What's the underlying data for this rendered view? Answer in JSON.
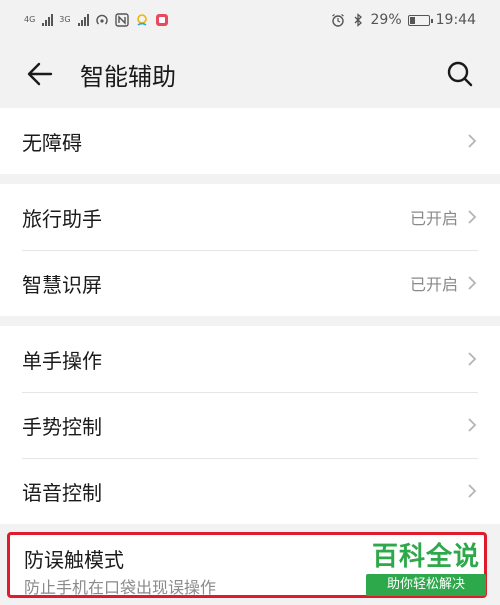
{
  "status_bar": {
    "net1": "4G",
    "net2": "3G",
    "battery_percent_text": "29%",
    "battery_level": 0.29,
    "time": "19:44"
  },
  "header": {
    "title": "智能辅助"
  },
  "groups": [
    {
      "items": [
        {
          "label": "无障碍",
          "value": ""
        }
      ]
    },
    {
      "items": [
        {
          "label": "旅行助手",
          "value": "已开启"
        },
        {
          "label": "智慧识屏",
          "value": "已开启"
        }
      ]
    },
    {
      "items": [
        {
          "label": "单手操作",
          "value": ""
        },
        {
          "label": "手势控制",
          "value": ""
        },
        {
          "label": "语音控制",
          "value": ""
        }
      ]
    }
  ],
  "highlighted_item": {
    "title": "防误触模式",
    "subtitle": "防止手机在口袋出现误操作"
  },
  "watermark": {
    "title": "百科全说",
    "subtitle": "助你轻松解决"
  },
  "colors": {
    "highlight_border": "#e01b2b",
    "watermark_green": "#2da84a"
  }
}
